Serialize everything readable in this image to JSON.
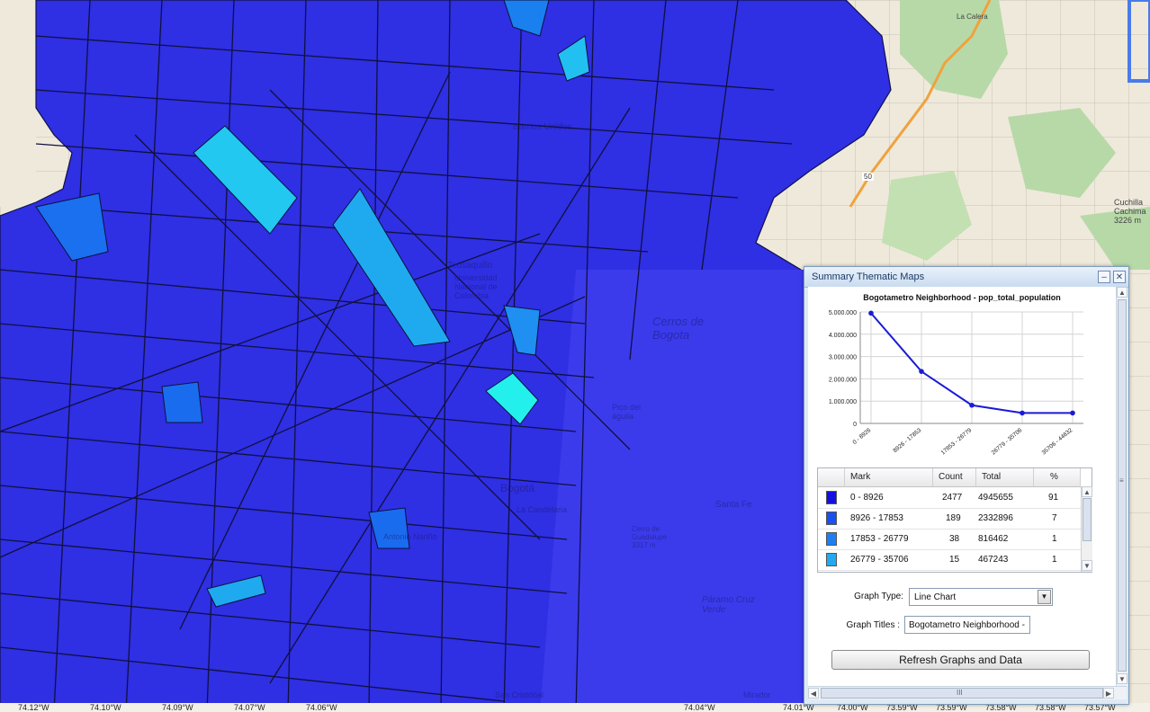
{
  "map": {
    "labels": [
      "Barrios Unidos",
      "Teusaquillo",
      "Universidad Nacional de Colombia",
      "Cerros de Bogota",
      "Pico del águila",
      "Santa Fe",
      "Bogotá",
      "La Candelaria",
      "Antonio Nariño",
      "San Cristóbal",
      "Páramo Cruz Verde",
      "Cerro de Guadalupe 3317 m",
      "Cuchilla Cachima 3226 m",
      "La Calera",
      "50",
      "Mirador"
    ],
    "coords": [
      "74.12°W",
      "74.10°W",
      "74.09°W",
      "74.07°W",
      "74.06°W",
      "74.04°W",
      "74.01°W",
      "74.00°W",
      "73.59°W",
      "73.59°W",
      "73.58°W",
      "73.58°W",
      "73.57°W"
    ]
  },
  "panel": {
    "title": "Summary Thematic Maps",
    "minimize_icon": "minimize-icon",
    "close_icon": "close-icon"
  },
  "chart_data": {
    "type": "line",
    "title": "Bogotametro Neighborhood - pop_total_population",
    "categories": [
      "0 - 8926",
      "8926 - 17853",
      "17853 - 26779",
      "26779 - 35706",
      "35706 - 44632"
    ],
    "values": [
      4945655,
      2332896,
      816462,
      467243,
      467243
    ],
    "y_ticks": [
      "0",
      "1.000.000",
      "2.000.000",
      "3.000.000",
      "4.000.000",
      "5.000.000"
    ],
    "ylim": [
      0,
      5000000
    ],
    "grid": true,
    "series_color": "#1a1ad6"
  },
  "table": {
    "headers": [
      "Mark",
      "Count",
      "Total",
      "%"
    ],
    "rows": [
      {
        "mark": "0 - 8926",
        "count": "2477",
        "total": "4945655",
        "pct": "91",
        "color": "#1212e0"
      },
      {
        "mark": "8926 - 17853",
        "count": "189",
        "total": "2332896",
        "pct": "7",
        "color": "#1a4ff0"
      },
      {
        "mark": "17853 - 26779",
        "count": "38",
        "total": "816462",
        "pct": "1",
        "color": "#1f7ff2"
      },
      {
        "mark": "26779 - 35706",
        "count": "15",
        "total": "467243",
        "pct": "1",
        "color": "#22aaf0"
      }
    ]
  },
  "controls": {
    "graph_type_label": "Graph Type:",
    "graph_type_value": "Line Chart",
    "graph_titles_label": "Graph Titles :",
    "graph_titles_value": "Bogotametro Neighborhood - pop_total_population",
    "refresh_label": "Refresh Graphs and Data",
    "hscroll_grip": "III",
    "vscroll_grip": "≡"
  }
}
